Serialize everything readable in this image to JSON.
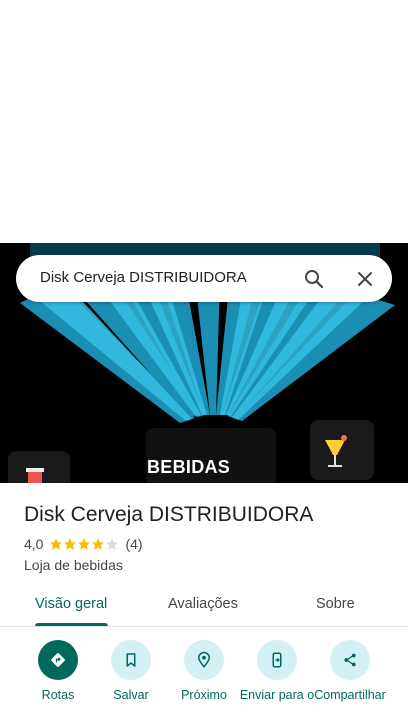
{
  "search": {
    "query": "Disk Cerveja DISTRIBUIDORA"
  },
  "hero": {
    "label": "BEBIDAS"
  },
  "place": {
    "name": "Disk Cerveja DISTRIBUIDORA",
    "rating": "4,0",
    "rating_value": 4.0,
    "reviews": "(4)",
    "category": "Loja de bebidas"
  },
  "tabs": [
    {
      "label": "Visão geral",
      "active": true
    },
    {
      "label": "Avaliações",
      "active": false
    },
    {
      "label": "Sobre",
      "active": false
    }
  ],
  "actions": [
    {
      "label": "Rotas",
      "icon": "directions-icon"
    },
    {
      "label": "Salvar",
      "icon": "bookmark-icon"
    },
    {
      "label": "Próximo",
      "icon": "nearby-icon"
    },
    {
      "label": "Enviar para o",
      "icon": "send-to-phone-icon"
    },
    {
      "label": "Compartilhar",
      "icon": "share-icon"
    }
  ],
  "colors": {
    "accent": "#00695c",
    "chip": "#d3f0f5",
    "star": "#fbbc04",
    "hero_rays": "#1fa3c9"
  }
}
